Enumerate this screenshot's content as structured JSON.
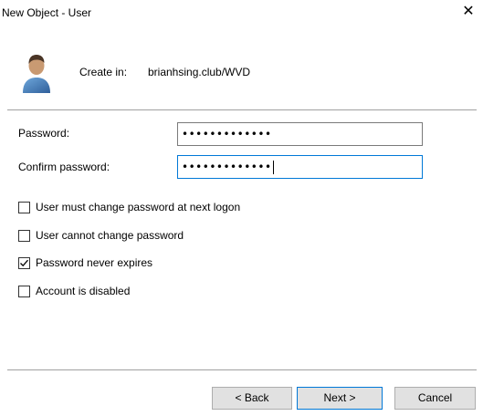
{
  "window": {
    "title": "New Object - User",
    "close_glyph": "✕"
  },
  "header": {
    "create_in_label": "Create in:",
    "create_in_path": "brianhsing.club/WVD",
    "icon": "user-avatar-icon"
  },
  "form": {
    "password_label": "Password:",
    "password_value": "•••••••••••••",
    "confirm_label": "Confirm password:",
    "confirm_value": "•••••••••••••"
  },
  "options": [
    {
      "label": "User must change password at next logon",
      "checked": false
    },
    {
      "label": "User cannot change password",
      "checked": false
    },
    {
      "label": "Password never expires",
      "checked": true
    },
    {
      "label": "Account is disabled",
      "checked": false
    }
  ],
  "buttons": {
    "back": "< Back",
    "next": "Next >",
    "cancel": "Cancel"
  },
  "colors": {
    "focus_border": "#0078d7",
    "button_face": "#e1e1e1"
  }
}
